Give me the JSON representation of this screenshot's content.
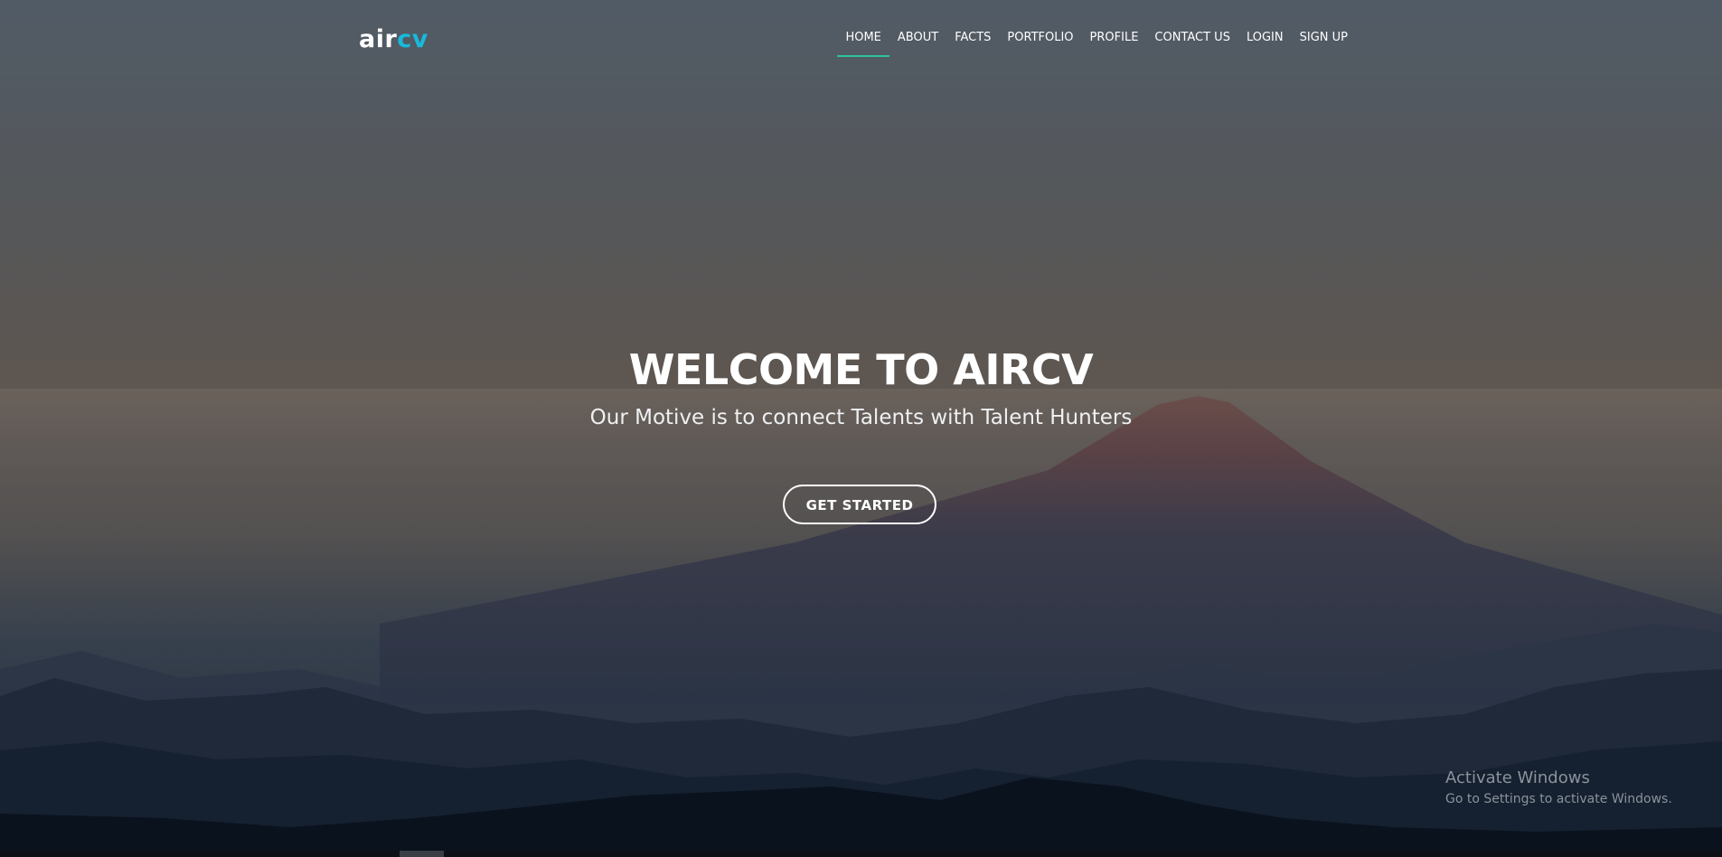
{
  "brand": {
    "logo_part1": "air",
    "logo_part2": "cv",
    "accent_color": "#18b9da"
  },
  "nav": {
    "active_underline_color": "#2dc29d",
    "items": [
      {
        "label": "HOME",
        "active": true
      },
      {
        "label": "ABOUT",
        "active": false
      },
      {
        "label": "FACTS",
        "active": false
      },
      {
        "label": "PORTFOLIO",
        "active": false
      },
      {
        "label": "PROFILE",
        "active": false
      },
      {
        "label": "CONTACT US",
        "active": false
      },
      {
        "label": "LOGIN",
        "active": false
      },
      {
        "label": "SIGN UP",
        "active": false
      }
    ]
  },
  "hero": {
    "title": "WELCOME TO AIRCV",
    "subtitle": "Our Motive is to connect Talents with Talent Hunters",
    "cta_label": "GET STARTED"
  },
  "watermark": {
    "line1": "Activate Windows",
    "line2": "Go to Settings to activate Windows."
  }
}
